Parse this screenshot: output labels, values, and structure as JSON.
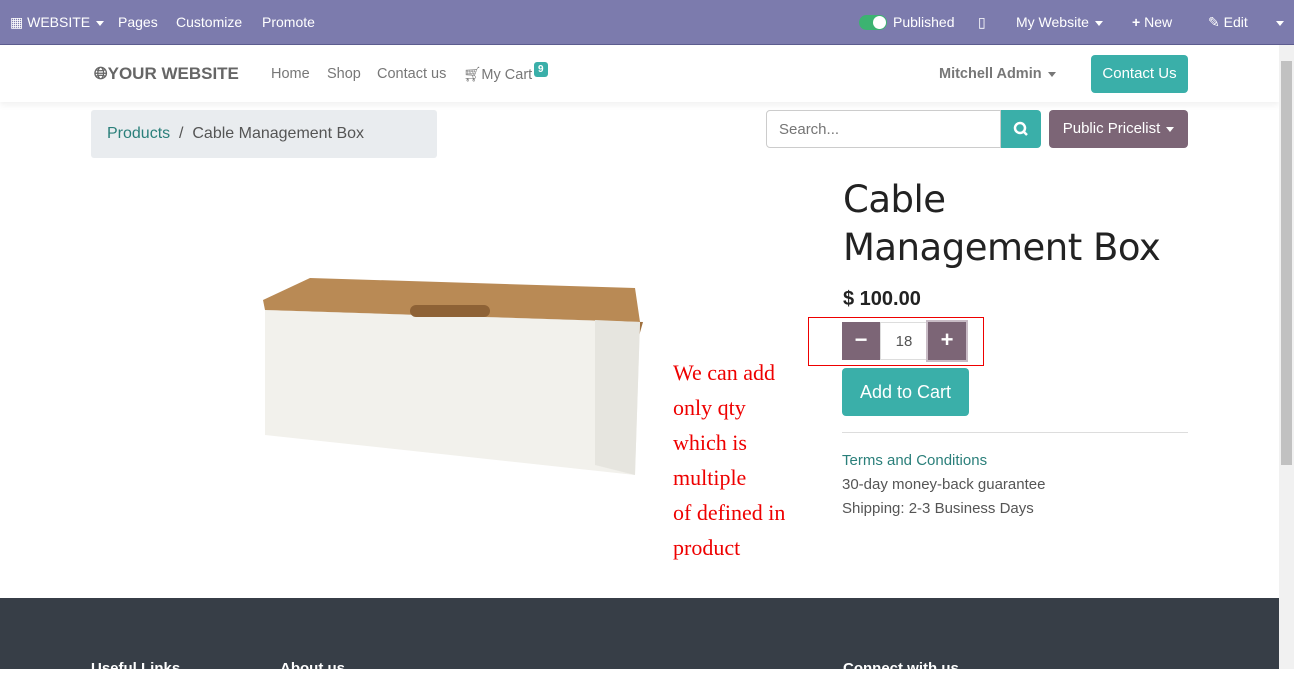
{
  "topbar": {
    "website": "WEBSITE",
    "pages": "Pages",
    "customize": "Customize",
    "promote": "Promote",
    "published": "Published",
    "my_website": "My Website",
    "new": "New",
    "edit": "Edit"
  },
  "header": {
    "logo": "YOUR WEBSITE",
    "nav": [
      "Home",
      "Shop",
      "Contact us",
      "My Cart"
    ],
    "cart_count": "9",
    "user": "Mitchell Admin",
    "contact_button": "Contact Us"
  },
  "breadcrumb": {
    "parent": "Products",
    "separator": "/",
    "current": "Cable Management Box"
  },
  "search": {
    "placeholder": "Search...",
    "pricelist": "Public Pricelist"
  },
  "product": {
    "name": "Cable Management Box",
    "price": "$ 100.00",
    "quantity": "18",
    "add_to_cart": "Add to Cart",
    "terms": "Terms and Conditions",
    "guarantee": "30-day money-back guarantee",
    "shipping": "Shipping: 2-3 Business Days"
  },
  "annotation": [
    "We can add",
    "only qty",
    "which is",
    "multiple",
    "of defined in",
    "product"
  ],
  "footer": {
    "col1": "Useful Links",
    "col2": "About us",
    "col3": "Connect with us"
  }
}
